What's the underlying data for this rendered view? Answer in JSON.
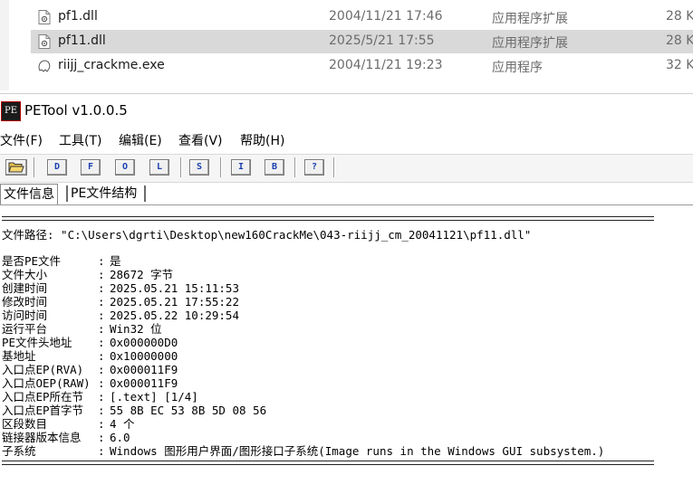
{
  "explorer": {
    "files": [
      {
        "name": "pf1.dll",
        "modified": "2004/11/21 17:46",
        "type": "应用程序扩展",
        "size": "28 K",
        "icon": "dll-file-icon",
        "selected": false
      },
      {
        "name": "pf11.dll",
        "modified": "2025/5/21 17:55",
        "type": "应用程序扩展",
        "size": "28 K",
        "icon": "dll-file-icon",
        "selected": true
      },
      {
        "name": "riijj_crackme.exe",
        "modified": "2004/11/21 19:23",
        "type": "应用程序",
        "size": "32 K",
        "icon": "exe-file-icon",
        "selected": false
      }
    ]
  },
  "window": {
    "logo": "PE",
    "title": "PETool v1.0.0.5"
  },
  "menu": [
    "文件(F)",
    "工具(T)",
    "编辑(E)",
    "查看(V)",
    "帮助(H)"
  ],
  "toolbar": {
    "open_icon": "open-folder-icon",
    "buttons": [
      "D",
      "F",
      "O",
      "L",
      "S",
      "I",
      "B",
      "?"
    ]
  },
  "tabs": [
    {
      "label": "文件信息",
      "active": true
    },
    {
      "label": "PE文件结构",
      "active": false
    }
  ],
  "content": {
    "path_line": "文件路径: \"C:\\Users\\dgrti\\Desktop\\new160CrackMe\\043-riijj_cm_20041121\\pf11.dll\"",
    "rows": [
      {
        "key": "是否PE文件",
        "value": "是"
      },
      {
        "key": "文件大小",
        "value": "28672 字节"
      },
      {
        "key": "创建时间",
        "value": "2025.05.21 15:11:53"
      },
      {
        "key": "修改时间",
        "value": "2025.05.21 17:55:22"
      },
      {
        "key": "访问时间",
        "value": "2025.05.22 10:29:54"
      },
      {
        "key": "运行平台",
        "value": "Win32 位"
      },
      {
        "key": "PE文件头地址",
        "value": "0x000000D0"
      },
      {
        "key": "基地址",
        "value": "0x10000000"
      },
      {
        "key": "入口点EP(RVA)",
        "value": "0x000011F9"
      },
      {
        "key": "入口点OEP(RAW)",
        "value": "0x000011F9"
      },
      {
        "key": "入口点EP所在节",
        "value": "[.text] [1/4]"
      },
      {
        "key": "入口点EP首字节",
        "value": "55 8B EC 53 8B 5D 08 56"
      },
      {
        "key": "区段数目",
        "value": "4 个"
      },
      {
        "key": "链接器版本信息",
        "value": "6.0"
      },
      {
        "key": "子系统",
        "value": "Windows 图形用户界面/图形接口子系统(Image runs in the Windows GUI subsystem.)"
      }
    ]
  }
}
